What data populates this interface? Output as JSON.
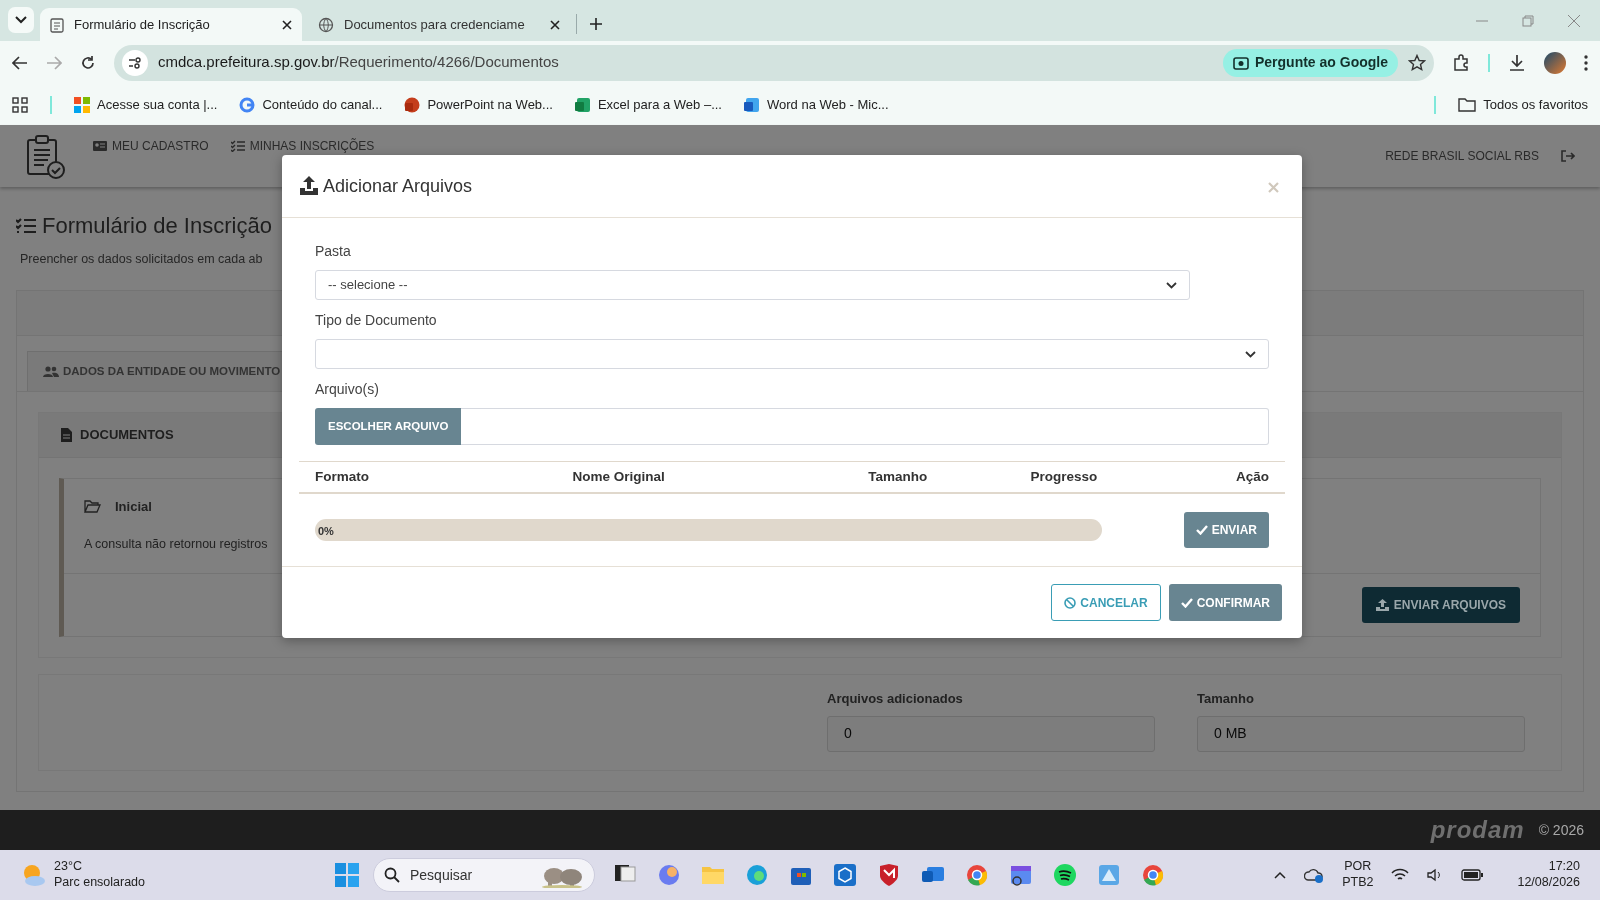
{
  "browser": {
    "tabs": [
      {
        "title": "Formulário de Inscrição",
        "selected": true
      },
      {
        "title": "Documentos para credenciame",
        "selected": false
      }
    ],
    "url_host": "cmdca.prefeitura.sp.gov.br",
    "url_path": "/Requerimento/4266/Documentos",
    "ask_google": "Pergunte ao Google",
    "bookmarks": [
      "Acesse sua conta |...",
      "Conteúdo do canal...",
      "PowerPoint na Web...",
      "Excel para a Web –...",
      "Word na Web - Mic..."
    ],
    "all_bookmarks": "Todos os favoritos"
  },
  "header": {
    "nav": [
      "MEU CADASTRO",
      "MINHAS INSCRIÇÕES"
    ],
    "user": "REDE BRASIL SOCIAL RBS"
  },
  "page": {
    "title": "Formulário de Inscrição",
    "subtitle": "Preencher os dados solicitados em cada ab",
    "tab": "DADOS DA ENTIDADE OU MOVIMENTO",
    "documents_title": "DOCUMENTOS",
    "folder": {
      "name": "Inicial",
      "message": "A consulta não retornou registros"
    },
    "send_button": "ENVIAR ARQUIVOS",
    "summary": [
      {
        "label": "Arquivos adicionados",
        "value": "0"
      },
      {
        "label": "Tamanho",
        "value": "0 MB"
      }
    ]
  },
  "modal": {
    "title": "Adicionar Arquivos",
    "fields": [
      {
        "kind": "select",
        "label": "Pasta",
        "value": "-- selecione --"
      },
      {
        "kind": "select",
        "label": "Tipo de Documento"
      },
      {
        "kind": "file",
        "label": "Arquivo(s)",
        "button": "ESCOLHER ARQUIVO"
      }
    ],
    "columns": [
      "Formato",
      "Nome Original",
      "Tamanho",
      "Progresso",
      "Ação"
    ],
    "upload": {
      "level": 0,
      "reading": "0%",
      "button": "ENVIAR"
    },
    "buttons": [
      {
        "kind": "outline",
        "label": "CANCELAR"
      },
      {
        "kind": "solid",
        "label": "CONFIRMAR"
      }
    ]
  },
  "footer": {
    "brand": "prodam",
    "copyright": "© 2026"
  },
  "taskbar": {
    "temperature": "23°C",
    "weather": "Parc ensolarado",
    "search_placeholder": "Pesquisar",
    "language": "POR",
    "layout": "PTB2",
    "time": "17:20",
    "date": "12/08/2026"
  }
}
